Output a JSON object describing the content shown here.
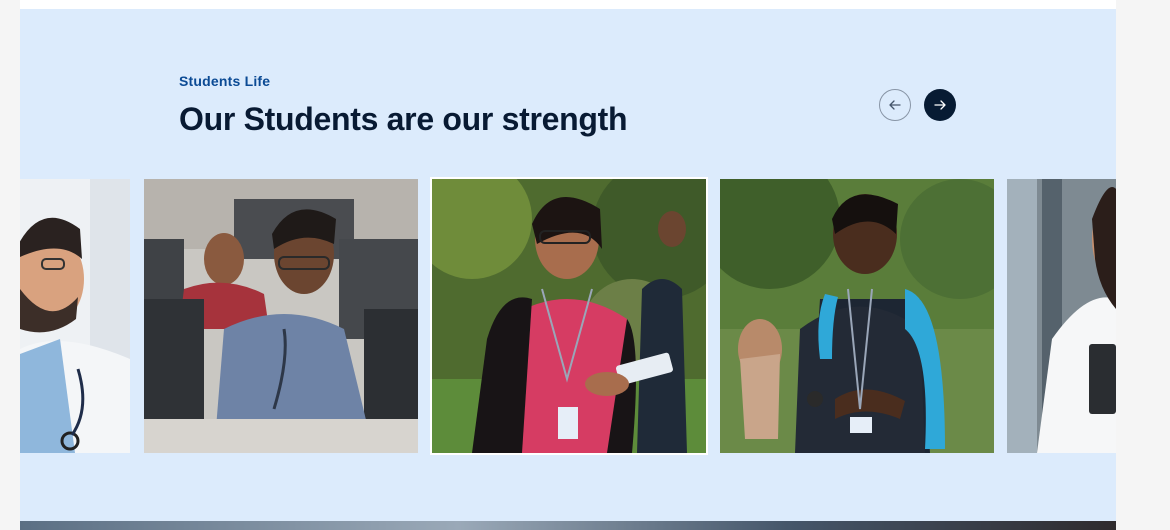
{
  "section": {
    "eyebrow": "Students Life",
    "heading": "Our Students are our strength"
  },
  "carousel": {
    "prev_icon": "arrow-left-icon",
    "next_icon": "arrow-right-icon",
    "cards": [
      {
        "subject": "doctor-in-white-coat"
      },
      {
        "subject": "student-in-computer-lab"
      },
      {
        "subject": "student-with-books-on-campus"
      },
      {
        "subject": "student-with-backpack-on-campus"
      },
      {
        "subject": "doctor-with-tablet"
      }
    ]
  },
  "colors": {
    "section_bg": "#dcebfc",
    "accent": "#0b4a94",
    "heading": "#081a33",
    "next_button": "#071b33"
  }
}
